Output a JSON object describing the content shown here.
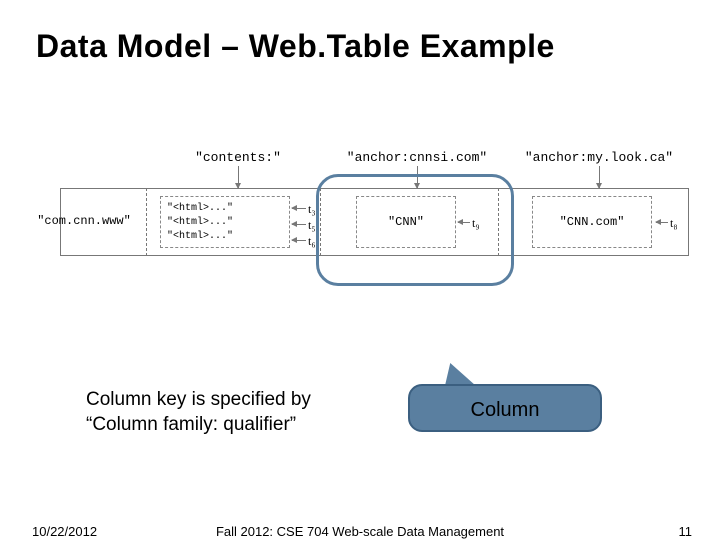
{
  "title": "Data Model – Web.Table Example",
  "row_key": "\"com.cnn.www\"",
  "columns": {
    "contents": {
      "header": "\"contents:\"",
      "versions": [
        "\"<html>...\"",
        "\"<html>...\"",
        "\"<html>...\""
      ],
      "ts": [
        "t₃",
        "t₅",
        "t₆"
      ]
    },
    "anchor1": {
      "header": "\"anchor:cnnsi.com\"",
      "value": "\"CNN\"",
      "ts": "t₉"
    },
    "anchor2": {
      "header": "\"anchor:my.look.ca\"",
      "value": "\"CNN.com\"",
      "ts": "t₈"
    }
  },
  "callout_label": "Column",
  "caption_line1": "Column key is specified by",
  "caption_line2": "“Column family: qualifier”",
  "footer": {
    "date": "10/22/2012",
    "course": "Fall 2012: CSE 704 Web-scale Data Management",
    "page": "11"
  }
}
